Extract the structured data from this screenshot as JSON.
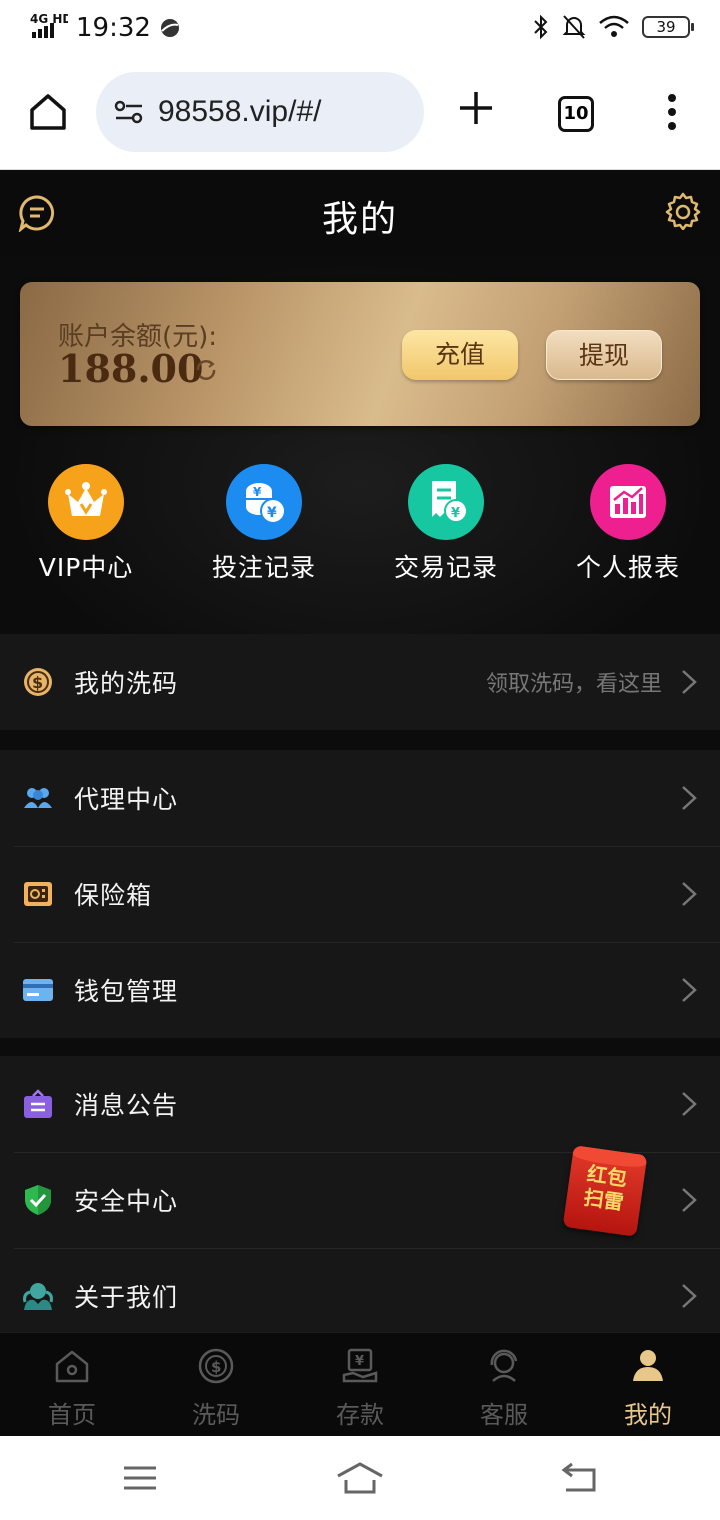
{
  "status_bar": {
    "network": "4G HD",
    "time": "19:32",
    "battery": "39"
  },
  "browser": {
    "url": "98558.vip/#/",
    "tab_count": "10"
  },
  "header": {
    "title": "我的"
  },
  "balance": {
    "label": "账户余额(元):",
    "value": "188.00",
    "recharge_label": "充值",
    "withdraw_label": "提现"
  },
  "quick_links": [
    {
      "label": "VIP中心",
      "icon": "crown-icon",
      "color": "#f7a21b"
    },
    {
      "label": "投注记录",
      "icon": "coins-icon",
      "color": "#1d8cf0"
    },
    {
      "label": "交易记录",
      "icon": "receipt-icon",
      "color": "#16c7a2"
    },
    {
      "label": "个人报表",
      "icon": "chart-icon",
      "color": "#ee1f8f"
    }
  ],
  "menu": {
    "wash": {
      "label": "我的洗码",
      "hint": "领取洗码，看这里"
    },
    "group1": [
      {
        "label": "代理中心",
        "icon": "users-icon"
      },
      {
        "label": "保险箱",
        "icon": "safe-icon"
      },
      {
        "label": "钱包管理",
        "icon": "wallet-card-icon"
      }
    ],
    "group2": [
      {
        "label": "消息公告",
        "icon": "notice-bag-icon"
      },
      {
        "label": "安全中心",
        "icon": "shield-check-icon"
      },
      {
        "label": "关于我们",
        "icon": "about-icon"
      }
    ]
  },
  "red_packet": {
    "line1": "红包",
    "line2": "扫雷"
  },
  "bottom_nav": [
    {
      "label": "首页",
      "icon": "home-icon"
    },
    {
      "label": "洗码",
      "icon": "dollar-circle-icon"
    },
    {
      "label": "存款",
      "icon": "deposit-icon"
    },
    {
      "label": "客服",
      "icon": "support-icon"
    },
    {
      "label": "我的",
      "icon": "person-icon",
      "active": true
    }
  ]
}
